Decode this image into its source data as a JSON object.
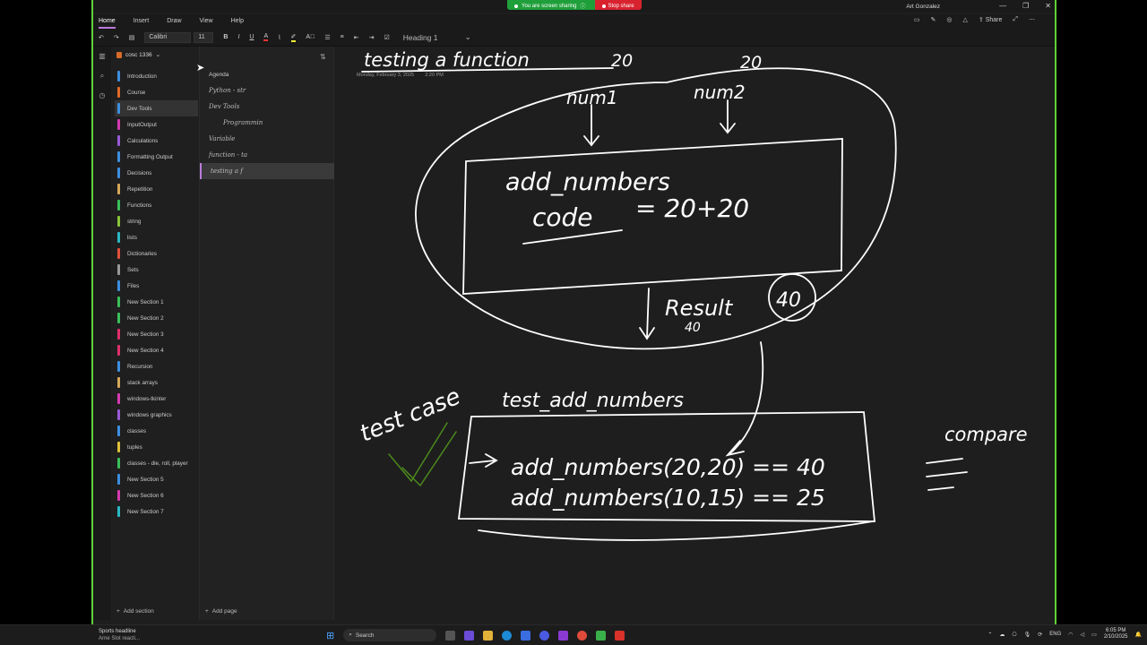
{
  "screen_share": {
    "message": "You are screen sharing",
    "stop": "Stop share"
  },
  "user": "Art Gonzalez",
  "menu": {
    "items": [
      "Home",
      "Insert",
      "Draw",
      "View",
      "Help"
    ]
  },
  "right_tools": {
    "share": "Share"
  },
  "ribbon": {
    "font": "Calibri",
    "size": "11",
    "style": "Heading 1"
  },
  "notebook": {
    "name": "cosc 1336"
  },
  "sections": [
    {
      "label": "Introduction",
      "color": "#3d8fe0"
    },
    {
      "label": "Course",
      "color": "#e06a2a"
    },
    {
      "label": "Dev Tools",
      "color": "#3d8fe0",
      "selected": true
    },
    {
      "label": "InputOutput",
      "color": "#d43ab0"
    },
    {
      "label": "Calculations",
      "color": "#9a5ad6"
    },
    {
      "label": "Formatting Output",
      "color": "#3d8fe0"
    },
    {
      "label": "Decisions",
      "color": "#3d8fe0"
    },
    {
      "label": "Repetition",
      "color": "#d6a85a"
    },
    {
      "label": "Functions",
      "color": "#3bbf5a"
    },
    {
      "label": "string",
      "color": "#8ac43a"
    },
    {
      "label": "lists",
      "color": "#2ab8c4"
    },
    {
      "label": "Dictionaries",
      "color": "#e0503a"
    },
    {
      "label": "Sets",
      "color": "#999999"
    },
    {
      "label": "Files",
      "color": "#3d8fe0"
    },
    {
      "label": "New Section 1",
      "color": "#3bbf5a"
    },
    {
      "label": "New Section 2",
      "color": "#3bbf5a"
    },
    {
      "label": "New Section 3",
      "color": "#e0306a"
    },
    {
      "label": "New Section 4",
      "color": "#e0306a"
    },
    {
      "label": "Recursion",
      "color": "#3d8fe0"
    },
    {
      "label": "stack arrays",
      "color": "#d6a85a"
    },
    {
      "label": "windows-tkinter",
      "color": "#d43ab0"
    },
    {
      "label": "windows graphics",
      "color": "#9a5ad6"
    },
    {
      "label": "classes",
      "color": "#3d8fe0"
    },
    {
      "label": "tuples",
      "color": "#e0c03a"
    },
    {
      "label": "classes - die, roll, player",
      "color": "#3bbf5a"
    },
    {
      "label": "New Section 5",
      "color": "#3d8fe0"
    },
    {
      "label": "New Section 6",
      "color": "#d43ab0"
    },
    {
      "label": "New Section 7",
      "color": "#2ab8c4"
    }
  ],
  "add_section": "Add section",
  "pages": [
    {
      "label": "Agenda",
      "level": 0
    },
    {
      "label": "Python - str",
      "level": 1
    },
    {
      "label": "Dev Tools",
      "level": 1
    },
    {
      "label": "Programmin",
      "level": 2
    },
    {
      "label": "Variable",
      "level": 1
    },
    {
      "label": "function - ta",
      "level": 1
    },
    {
      "label": "testing a f",
      "level": 1,
      "selected": true
    }
  ],
  "add_page": "Add page",
  "canvas": {
    "date": "Monday, February 3, 2025",
    "time": "2:20 PM",
    "ink": {
      "title": "testing a function",
      "num1": "num1",
      "num2": "num2",
      "v20a": "20",
      "v20b": "20",
      "func": "add_numbers",
      "code": "code",
      "code_expr": "= 20+20",
      "result": "Result",
      "result_val": "40",
      "res40": "40",
      "test_case": "test case",
      "test_func": "test_add_numbers",
      "line1": "add_numbers(20,20) == 40",
      "line2": "add_numbers(10,15) == 25",
      "compare": "compare",
      "eq": "=="
    }
  },
  "taskbar": {
    "news_title": "Sports headline",
    "news_sub": "Arne Slot reacti...",
    "search": "Search",
    "lang": "ENG",
    "time": "6:05 PM",
    "date": "2/10/2025"
  }
}
